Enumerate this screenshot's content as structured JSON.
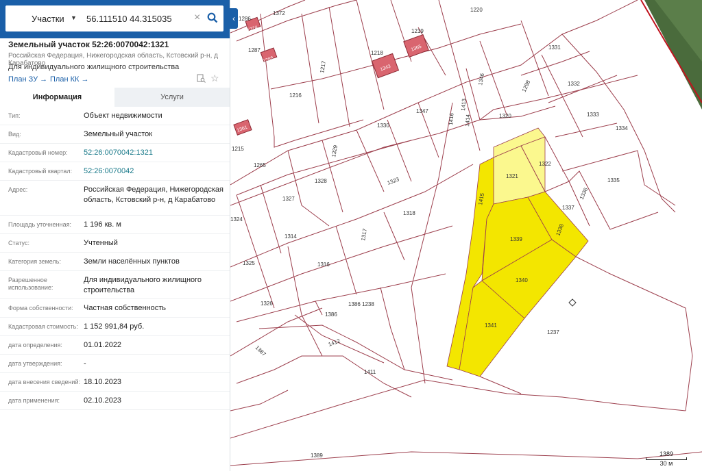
{
  "search": {
    "layer": "Участки",
    "query": "56.111510 44.315035"
  },
  "object": {
    "title": "Земельный участок 52:26:0070042:1321",
    "address": "Российская Федерация, Нижегородская область, Кстовский р-н, д Карабатово",
    "use": "Для индивидуального жилищного строительства",
    "plan_zu": "План ЗУ →",
    "plan_kk": "План КК →"
  },
  "tabs": {
    "info": "Информация",
    "services": "Услуги"
  },
  "rows": [
    {
      "label": "Тип:",
      "value": "Объект недвижимости"
    },
    {
      "label": "Вид:",
      "value": "Земельный участок"
    },
    {
      "label": "Кадастровый номер:",
      "value": "52:26:0070042:1321",
      "link": true
    },
    {
      "label": "Кадастровый квартал:",
      "value": "52:26:0070042",
      "link": true
    },
    {
      "label": "Адрес:",
      "value": "Российская Федерация, Нижегородская область, Кстовский р-н, д Карабатово"
    },
    {
      "label": "Площадь уточненная:",
      "value": "1 196 кв. м"
    },
    {
      "label": "Статус:",
      "value": "Учтенный"
    },
    {
      "label": "Категория земель:",
      "value": "Земли населённых пунктов"
    },
    {
      "label": "Разрешенное использование:",
      "value": "Для индивидуального жилищного строительства"
    },
    {
      "label": "Форма собственности:",
      "value": "Частная собственность"
    },
    {
      "label": "Кадастровая стоимость:",
      "value": "1 152 991,84 руб."
    },
    {
      "label": "дата определения:",
      "value": "01.01.2022"
    },
    {
      "label": "дата утверждения:",
      "value": "-"
    },
    {
      "label": "дата внесения сведений:",
      "value": "18.10.2023"
    },
    {
      "label": "дата применения:",
      "value": "02.10.2023"
    }
  ],
  "map": {
    "parcel_labels": [
      "1286",
      "1372",
      "1220",
      "1287",
      "1219",
      "1218",
      "1217",
      "1216",
      "1331",
      "1346",
      "1298",
      "1332",
      "1413",
      "1416",
      "1347",
      "1414",
      "1320",
      "1333",
      "1334",
      "1330",
      "1329",
      "1328",
      "1323",
      "1327",
      "1322",
      "1321",
      "1265",
      "1215",
      "1335",
      "1415",
      "1337",
      "1336",
      "1339",
      "1338",
      "1318",
      "1317",
      "1314",
      "1324",
      "1325",
      "1316",
      "1340",
      "1326",
      "1386",
      "1386 1238",
      "1237",
      "1341",
      "1387",
      "1412",
      "1411",
      "1389"
    ],
    "house_labels": [
      "1374",
      "1288",
      "1343",
      "1365",
      "1361"
    ],
    "scale_label": "30 м",
    "colors": {
      "highlight_light": "#fbf88e",
      "highlight": "#f3e600",
      "boundary": "#9c3e4c"
    }
  }
}
